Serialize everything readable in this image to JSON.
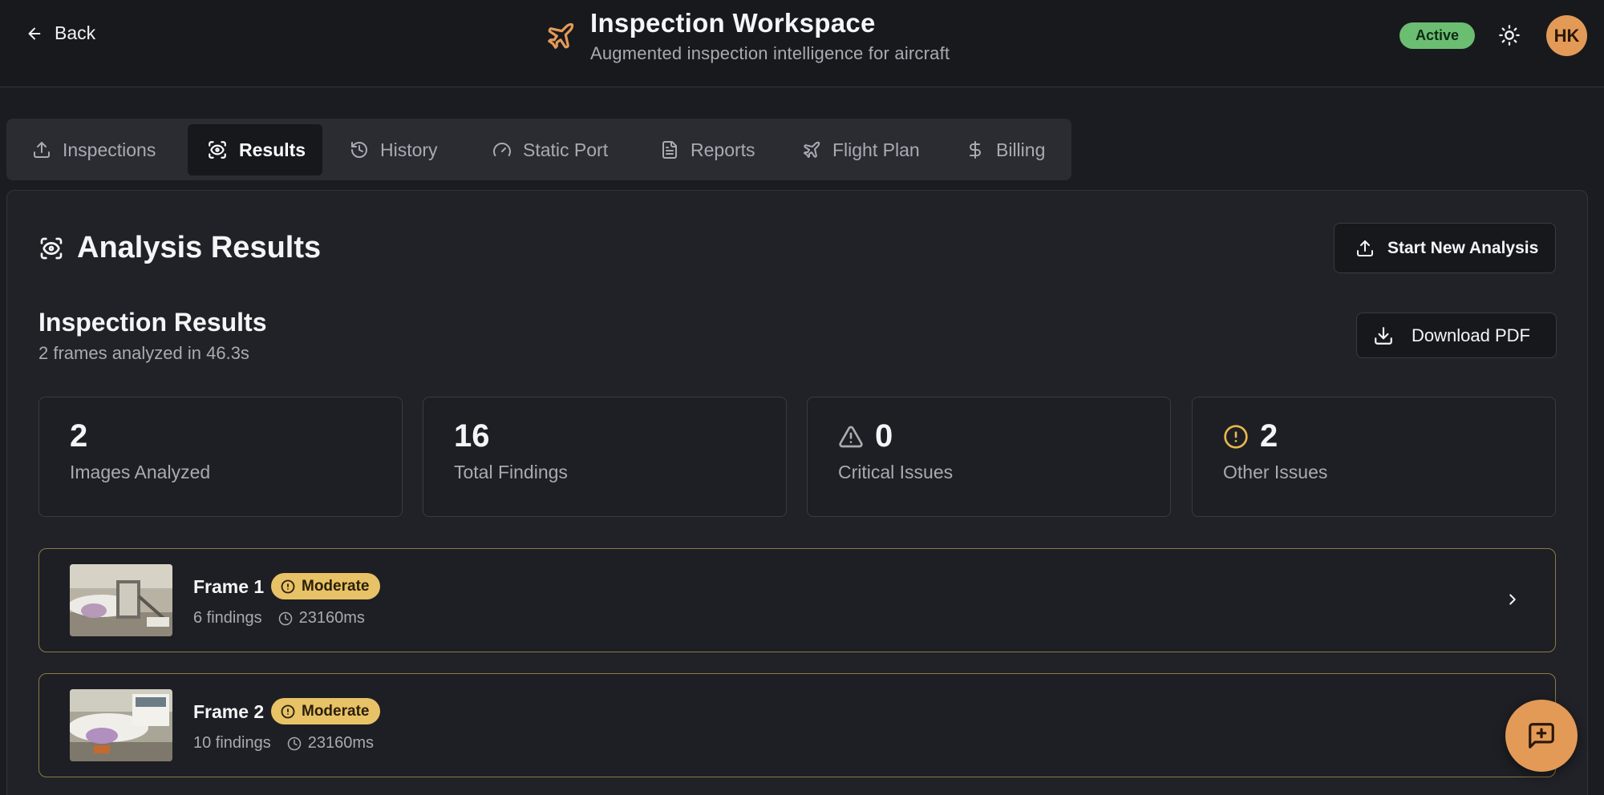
{
  "header": {
    "back_label": "Back",
    "title": "Inspection Workspace",
    "subtitle": "Augmented inspection intelligence for aircraft",
    "status": "Active",
    "avatar_initials": "HK"
  },
  "tabs": [
    {
      "label": "Inspections",
      "icon": "upload-icon",
      "active": false
    },
    {
      "label": "Results",
      "icon": "eye-scan-icon",
      "active": true
    },
    {
      "label": "History",
      "icon": "history-icon",
      "active": false
    },
    {
      "label": "Static Port",
      "icon": "gauge-icon",
      "active": false
    },
    {
      "label": "Reports",
      "icon": "document-icon",
      "active": false
    },
    {
      "label": "Flight Plan",
      "icon": "plane-icon",
      "active": false
    },
    {
      "label": "Billing",
      "icon": "dollar-icon",
      "active": false
    }
  ],
  "main": {
    "title": "Analysis Results",
    "start_new_label": "Start New Analysis",
    "results_title": "Inspection Results",
    "results_subtitle": "2 frames analyzed in 46.3s",
    "download_label": "Download PDF"
  },
  "stats": [
    {
      "value": "2",
      "label": "Images Analyzed"
    },
    {
      "value": "16",
      "label": "Total Findings"
    },
    {
      "value": "0",
      "label": "Critical Issues",
      "icon": "warning-triangle-icon"
    },
    {
      "value": "2",
      "label": "Other Issues",
      "icon": "alert-circle-icon"
    }
  ],
  "frames": [
    {
      "title": "Frame 1",
      "severity": "Moderate",
      "findings": "6 findings",
      "duration": "23160ms"
    },
    {
      "title": "Frame 2",
      "severity": "Moderate",
      "findings": "10 findings",
      "duration": "23160ms"
    }
  ],
  "colors": {
    "accent_orange": "#e39a57",
    "status_active": "#6bbd72",
    "severity_moderate": "#e8c266",
    "background": "#1b1c21"
  }
}
